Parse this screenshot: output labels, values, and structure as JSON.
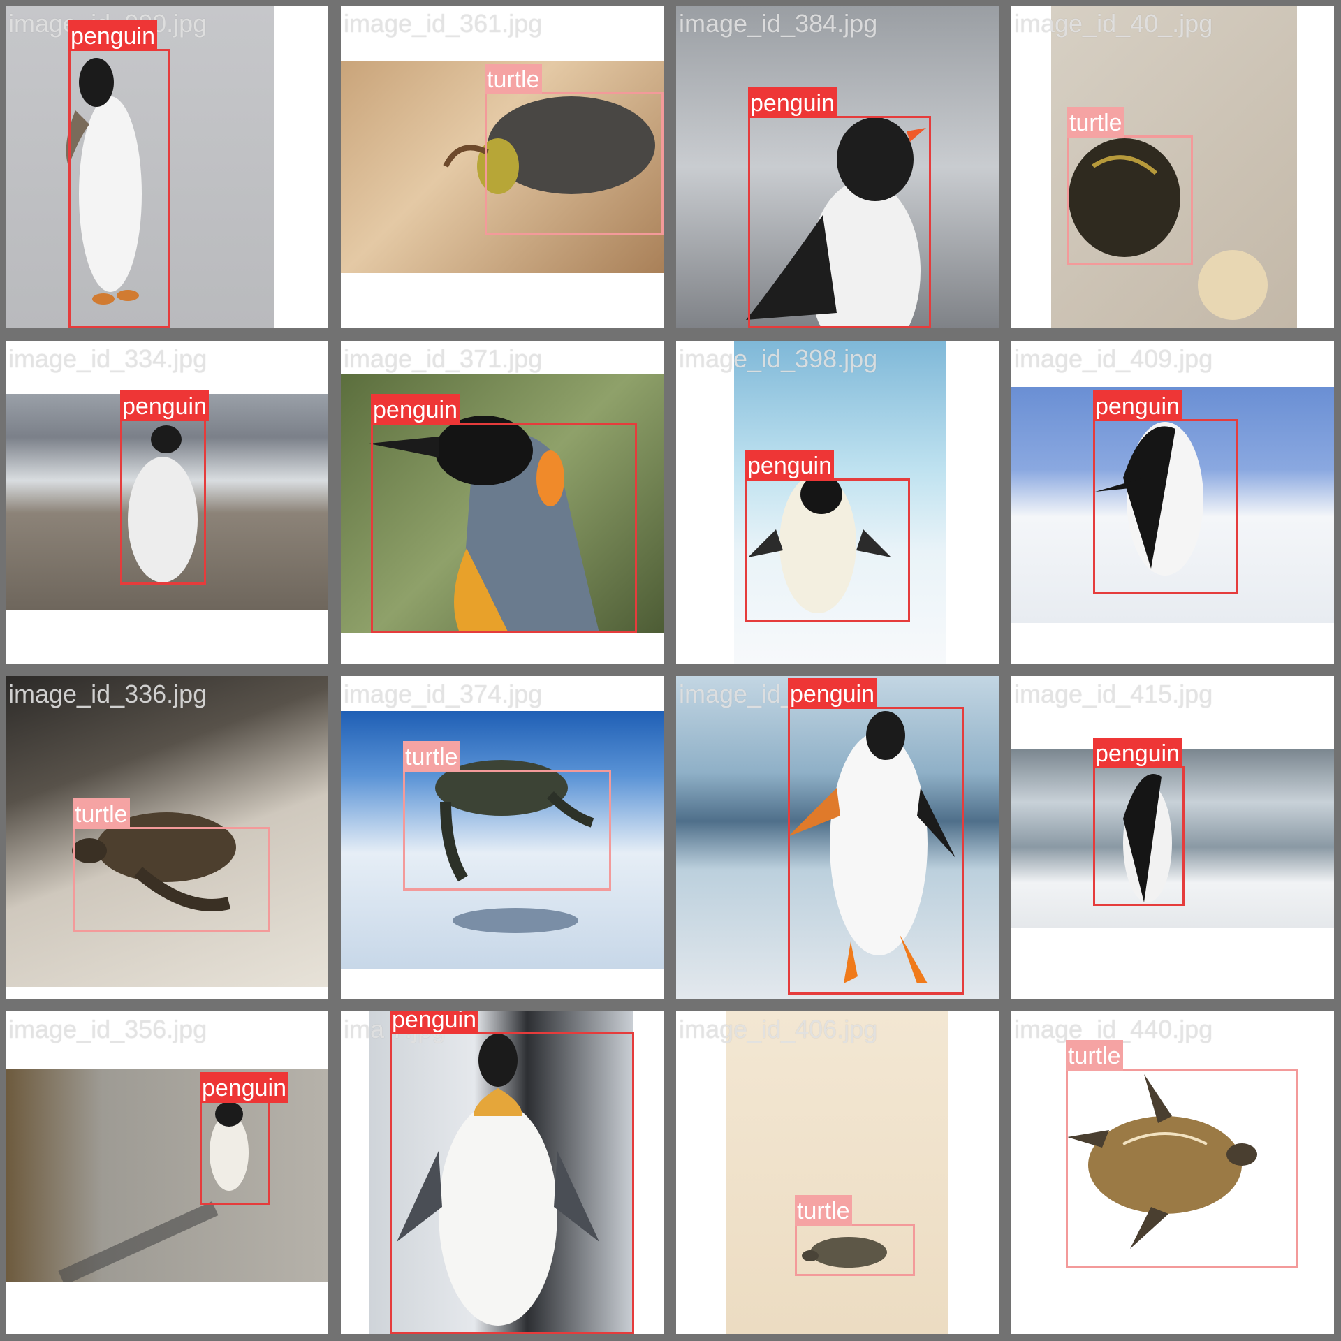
{
  "mosaic": {
    "tiles": [
      {
        "filename": "image_id_000.jpg",
        "label": "penguin"
      },
      {
        "filename": "image_id_361.jpg",
        "label": "turtle"
      },
      {
        "filename": "image_id_384.jpg",
        "label": "penguin"
      },
      {
        "filename": "image_id_40_.jpg",
        "label": "turtle"
      },
      {
        "filename": "image_id_334.jpg",
        "label": "penguin"
      },
      {
        "filename": "image_id_371.jpg",
        "label": "penguin"
      },
      {
        "filename": "image_id_398.jpg",
        "label": "penguin"
      },
      {
        "filename": "image_id_409.jpg",
        "label": "penguin"
      },
      {
        "filename": "image_id_336.jpg",
        "label": "turtle"
      },
      {
        "filename": "image_id_374.jpg",
        "label": "turtle"
      },
      {
        "filename": "image_id_",
        "label": "penguin"
      },
      {
        "filename": "image_id_415.jpg",
        "label": "penguin"
      },
      {
        "filename": "image_id_356.jpg",
        "label": "penguin"
      },
      {
        "filename": "ima 7.jpg",
        "label": "penguin"
      },
      {
        "filename": "image_id_406.jpg",
        "label": "turtle"
      },
      {
        "filename": "image_id_440.jpg",
        "label": "turtle"
      }
    ]
  },
  "colors": {
    "grid_border": "#727272",
    "penguin_box": "#e53c3c",
    "turtle_box": "#f39a9a"
  },
  "icons": {
    "penguin": "penguin-icon",
    "turtle": "turtle-icon"
  }
}
